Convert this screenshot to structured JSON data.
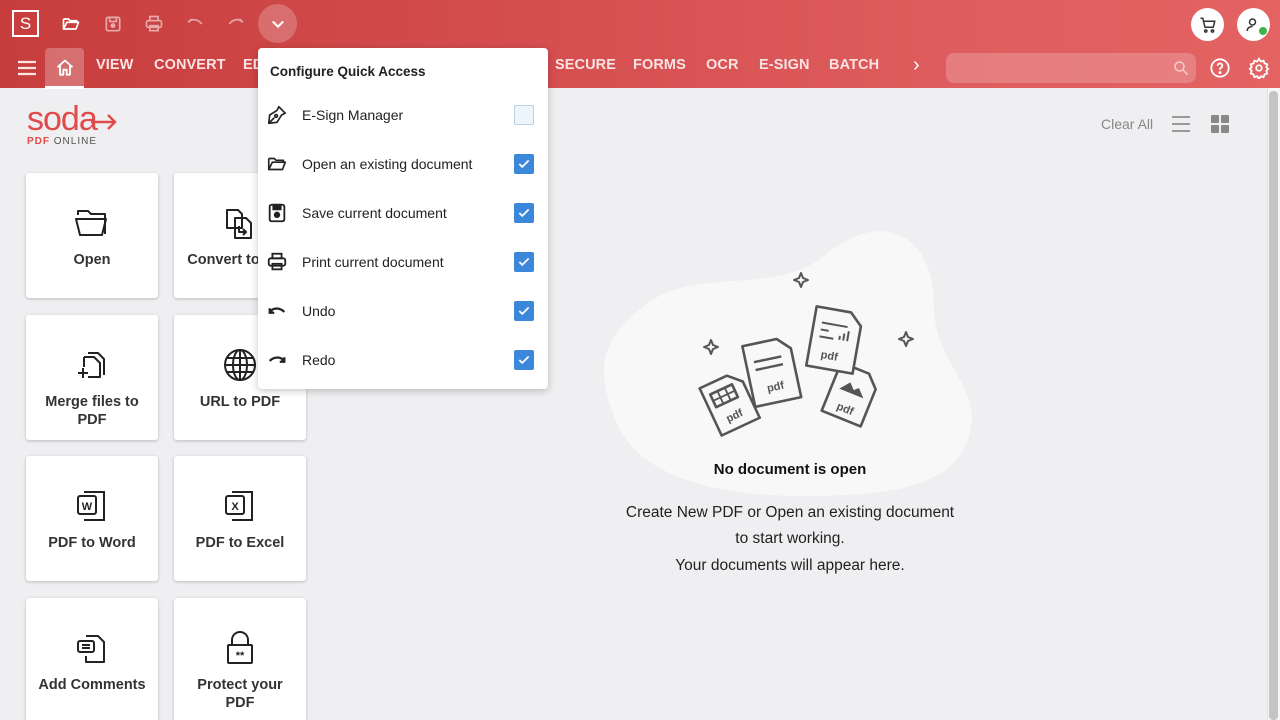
{
  "app": {
    "logo_letter": "S",
    "brand_name": "soda",
    "brand_sub_bold": "PDF",
    "brand_sub_rest": " ONLINE"
  },
  "quick_access": [
    {
      "icon": "folder-open-icon",
      "label": "Open"
    },
    {
      "icon": "save-icon",
      "label": "Save"
    },
    {
      "icon": "print-icon",
      "label": "Print"
    },
    {
      "icon": "undo-icon",
      "label": "Undo"
    },
    {
      "icon": "redo-icon",
      "label": "Redo"
    }
  ],
  "nav": {
    "items": [
      "VIEW",
      "CONVERT",
      "EDIT",
      "SECURE",
      "FORMS",
      "OCR",
      "E-SIGN",
      "BATCH"
    ],
    "active": "home",
    "more_glyph": "›"
  },
  "search": {
    "placeholder": "",
    "value": ""
  },
  "dropdown": {
    "title": "Configure Quick Access",
    "items": [
      {
        "icon": "pen-nib-icon",
        "label": "E-Sign Manager",
        "checked": false
      },
      {
        "icon": "folder-open-icon",
        "label": "Open an existing document",
        "checked": true
      },
      {
        "icon": "save-icon",
        "label": "Save current document",
        "checked": true
      },
      {
        "icon": "print-icon",
        "label": "Print current document",
        "checked": true
      },
      {
        "icon": "undo-icon",
        "label": "Undo",
        "checked": true
      },
      {
        "icon": "redo-icon",
        "label": "Redo",
        "checked": true
      }
    ]
  },
  "tiles": [
    {
      "icon": "folder-open-icon",
      "label": "Open"
    },
    {
      "icon": "convert-icon",
      "label": "Convert to PDF"
    },
    {
      "icon": "merge-icon",
      "label": "Merge files to PDF"
    },
    {
      "icon": "globe-icon",
      "label": "URL to PDF"
    },
    {
      "icon": "word-icon",
      "label": "PDF to Word"
    },
    {
      "icon": "excel-icon",
      "label": "PDF to Excel"
    },
    {
      "icon": "comments-icon",
      "label": "Add Comments"
    },
    {
      "icon": "lock-icon",
      "label": "Protect your PDF"
    }
  ],
  "documents": {
    "clear_all": "Clear All",
    "empty_title": "No document is open",
    "empty_lines": [
      "Create New PDF or Open an existing document",
      "to start working.",
      "Your documents will appear here."
    ],
    "illustration_labels": [
      "pdf",
      "pdf",
      "pdf",
      "pdf"
    ]
  },
  "colors": {
    "brand": "#e14a4a",
    "header_left": "#c73d3d",
    "header_right": "#e36262",
    "checkbox_on": "#3b87d9",
    "online_status": "#3bb54a"
  }
}
